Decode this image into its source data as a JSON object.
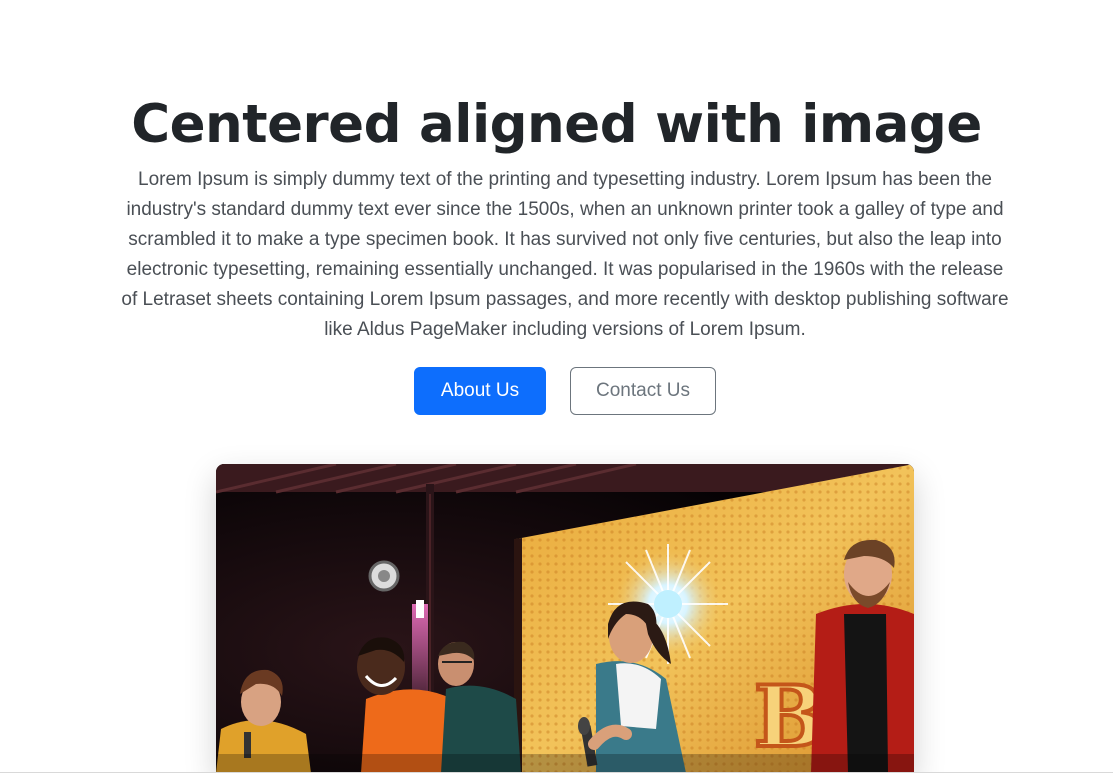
{
  "hero": {
    "title": "Centered aligned with image",
    "lead": "Lorem Ipsum is simply dummy text of the printing and typesetting industry. Lorem Ipsum has been the industry's standard dummy text ever since the 1500s, when an unknown printer took a galley of type and scrambled it to make a type specimen book. It has survived not only five centuries, but also the leap into electronic typesetting, remaining essentially unchanged. It was popularised in the 1960s with the release of Letraset sheets containing Lorem Ipsum passages, and more recently with desktop publishing software like Aldus PageMaker including versions of Lorem Ipsum.",
    "buttons": {
      "primary_label": "About Us",
      "secondary_label": "Contact Us"
    },
    "image": {
      "signage_text": "BO"
    }
  },
  "colors": {
    "primary": "#0d6efd",
    "secondary": "#6c757d",
    "text": "#212529"
  }
}
